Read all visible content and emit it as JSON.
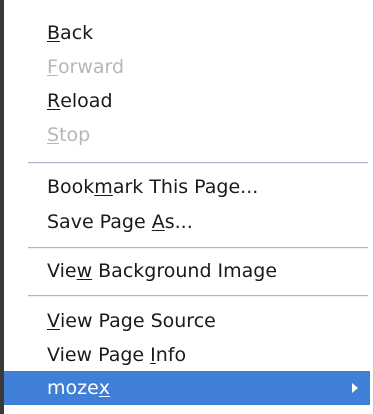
{
  "menu": {
    "items": [
      {
        "pre": "",
        "mn": "B",
        "post": "ack",
        "enabled": true
      },
      {
        "pre": "",
        "mn": "F",
        "post": "orward",
        "enabled": false
      },
      {
        "pre": "",
        "mn": "R",
        "post": "eload",
        "enabled": true
      },
      {
        "pre": "",
        "mn": "S",
        "post": "top",
        "enabled": false
      },
      {
        "pre": "Book",
        "mn": "m",
        "post": "ark This Page...",
        "enabled": true
      },
      {
        "pre": "Save Page ",
        "mn": "A",
        "post": "s...",
        "enabled": true
      },
      {
        "pre": "Vie",
        "mn": "w",
        "post": " Background Image",
        "enabled": true
      },
      {
        "pre": "",
        "mn": "V",
        "post": "iew Page Source",
        "enabled": true
      },
      {
        "pre": "View Page ",
        "mn": "I",
        "post": "nfo",
        "enabled": true
      },
      {
        "pre": "moze",
        "mn": "x",
        "post": "",
        "enabled": true,
        "selected": true,
        "has_submenu": true
      }
    ]
  },
  "colors": {
    "highlight": "#3f7fd8",
    "disabled_text": "#b7b7b7",
    "text": "#1a1a1a"
  },
  "icons": {
    "submenu": "submenu-arrow-icon"
  }
}
